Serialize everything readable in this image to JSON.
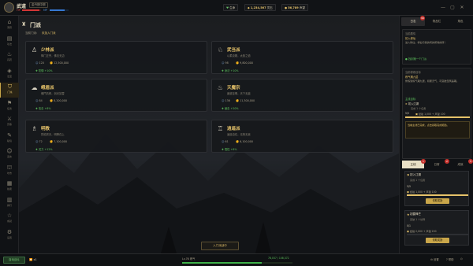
{
  "top": {
    "player_name": "武道",
    "player_title": "金丹期中期",
    "hp_label": "HP",
    "mp_label": "MP",
    "hp_fraction": 0.9,
    "mp_fraction": 0.8,
    "status": "生命",
    "spirit_stones": "1,234,567",
    "spirit_stones_unit": "灵石",
    "contribution": "56,789",
    "contribution_unit": "声望"
  },
  "nav": [
    {
      "icon": "home-icon",
      "glyph": "⌂",
      "label": "洞府"
    },
    {
      "icon": "book-icon",
      "glyph": "▤",
      "label": "功法"
    },
    {
      "icon": "cauldron-icon",
      "glyph": "♨",
      "label": "丹药"
    },
    {
      "icon": "treasure-icon",
      "glyph": "◈",
      "label": "法宝"
    },
    {
      "icon": "shield-icon",
      "glyph": "⛉",
      "label": "门派"
    },
    {
      "icon": "flag-icon",
      "glyph": "⚑",
      "label": "任务"
    },
    {
      "icon": "sword-icon",
      "glyph": "⚔",
      "label": "历练"
    },
    {
      "icon": "scroll-icon",
      "glyph": "✎",
      "label": "秘境"
    },
    {
      "icon": "people-icon",
      "glyph": "☺",
      "label": "道友"
    },
    {
      "icon": "shop-icon",
      "glyph": "⛫",
      "label": "坊市"
    },
    {
      "icon": "cart-icon",
      "glyph": "▦",
      "label": "拍卖"
    },
    {
      "icon": "chart-icon",
      "glyph": "▥",
      "label": "排行"
    },
    {
      "icon": "star-icon",
      "glyph": "☆",
      "label": "成就"
    },
    {
      "icon": "settings-icon",
      "glyph": "⚙",
      "label": "设置"
    }
  ],
  "main": {
    "title": "门派",
    "current_label": "当前门派:",
    "current_value": "未加入门派",
    "enter_button": "入门派战中",
    "sects": [
      {
        "name": "少林派",
        "desc": "禅门正宗，佛法无边",
        "members": "120",
        "power": "12,500,000",
        "bonus": "防御 +10%",
        "glyph": "♙"
      },
      {
        "name": "武当派",
        "desc": "以柔克刚，太极之道",
        "members": "98",
        "power": "9,800,000",
        "bonus": "身法 +10%",
        "glyph": "♘"
      },
      {
        "name": "峨眉派",
        "desc": "佛門清修，剑光如雪",
        "members": "84",
        "power": "8,200,000",
        "bonus": "攻击 +8%",
        "glyph": "☁"
      },
      {
        "name": "天魔宗",
        "desc": "魔道至尊，天下无敌",
        "members": "136",
        "power": "11,300,000",
        "bonus": "暴击 +20%",
        "glyph": "♨"
      },
      {
        "name": "明教",
        "desc": "烈焰焚天，明尊在上",
        "members": "72",
        "power": "7,100,000",
        "bonus": "灵力 +12%",
        "glyph": "♗"
      },
      {
        "name": "逍遥派",
        "desc": "逍遥自在，无拘无束",
        "members": "61",
        "power": "6,100,000",
        "bonus": "悟性 +8%",
        "glyph": "♖"
      }
    ]
  },
  "right": {
    "tabs": [
      {
        "label": "日志",
        "badge": "99"
      },
      {
        "label": "物品栏",
        "badge": ""
      },
      {
        "label": "角色",
        "badge": ""
      }
    ],
    "box1": {
      "title": "当前剧情",
      "subtitle": "初入修仙",
      "text": "进入修仙，修仙与我的何的所得的所！",
      "hint": "找到第一个门派"
    },
    "box2": {
      "title": "当前修炼目标",
      "subtitle": "炼气期九层",
      "text": "修炼到炼气期九层，积累灵气，可突破至筑基期。",
      "goal_label": "主线目标",
      "goal_item": "初入江湖",
      "goal_desc": "完成 1 个任务",
      "progress_text": "5/5",
      "progress_fraction": 1,
      "reward": "经验 1,000 + 声望 100",
      "warning": "当前主线已完成，点击领取完成奖励。"
    },
    "quest_tabs": [
      {
        "label": "主线",
        "badge": "1"
      },
      {
        "label": "日常",
        "badge": "2"
      },
      {
        "label": "成就",
        "badge": "5"
      }
    ],
    "quests": [
      {
        "title": "初入江湖",
        "desc": "完成 1 个任务",
        "progress": "5/5",
        "fraction": 1,
        "reward": "经验 1,000 + 声望 100",
        "button": "领取奖励"
      },
      {
        "title": "初露锋芒",
        "desc": "突破 1 个境界",
        "progress": "0/1",
        "fraction": 0,
        "reward": "经验 2,000 + 声望 200",
        "button": "领取奖励"
      }
    ]
  },
  "bottom": {
    "online_button": "自动战斗",
    "speed": "x1",
    "level": "Lv.76 炼气",
    "exp": "78,037 / 108,372",
    "exp_fraction": 0.72,
    "settings": "设置",
    "help": "帮助",
    "exit": "退出"
  }
}
